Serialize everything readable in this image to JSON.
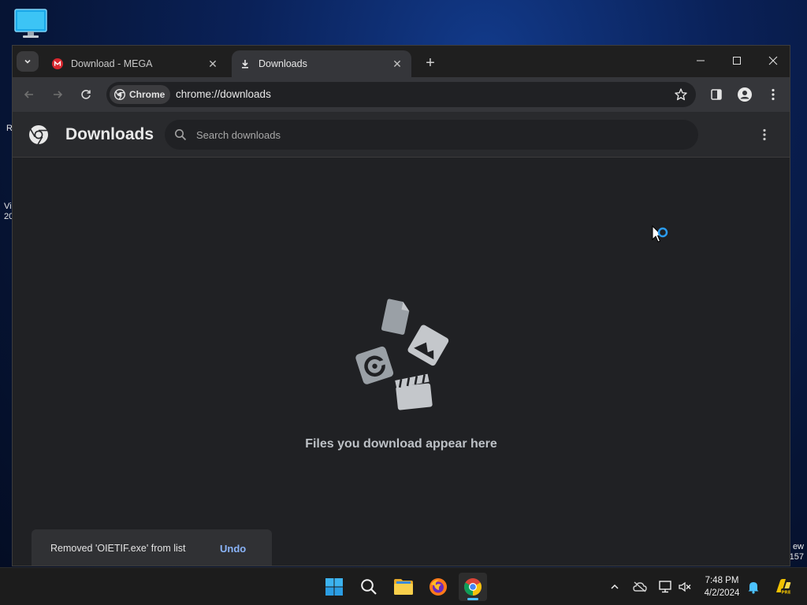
{
  "desktop": {
    "peek_left_1": "R",
    "peek_left_2": "Vi\n20",
    "peek_right": "ew\n157"
  },
  "browser": {
    "tabs": [
      {
        "title": "Download - MEGA",
        "icon": "mega-favicon",
        "active": false
      },
      {
        "title": "Downloads",
        "icon": "download-icon",
        "active": true
      }
    ],
    "new_tab_symbol": "+",
    "omnibox": {
      "chip_label": "Chrome",
      "url": "chrome://downloads"
    }
  },
  "page": {
    "title": "Downloads",
    "search_placeholder": "Search downloads",
    "empty_message": "Files you download appear here"
  },
  "toast": {
    "message": "Removed 'OIETIF.exe' from list",
    "action": "Undo"
  },
  "taskbar": {
    "apps": [
      "start-icon",
      "search-icon",
      "file-explorer-icon",
      "firefox-icon",
      "chrome-icon"
    ],
    "active_app": "chrome-icon",
    "clock_time": "7:48 PM",
    "clock_date": "4/2/2024"
  },
  "colors": {
    "window_bg": "#202124",
    "tab_active": "#35363a",
    "link_accent": "#8ab4f8",
    "taskbar_accent": "#4cc2ff"
  }
}
